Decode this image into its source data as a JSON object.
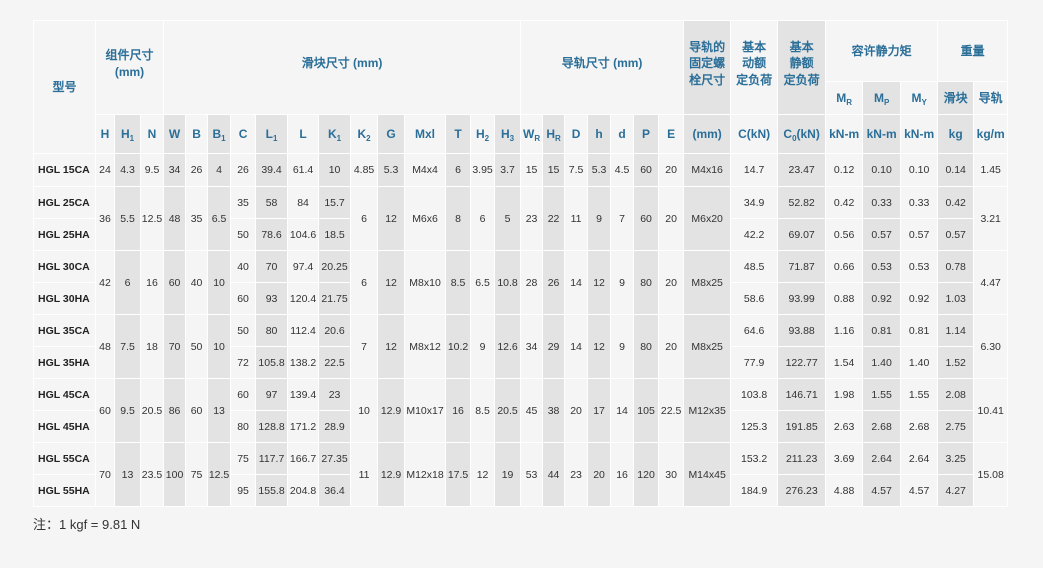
{
  "table": {
    "headers": {
      "model": "型号",
      "assembly": [
        "组件尺寸",
        "(mm)"
      ],
      "block": "滑块尺寸 (mm)",
      "rail": "导轨尺寸 (mm)",
      "bolt": [
        "导轨的",
        "固定螺",
        "栓尺寸"
      ],
      "dynamic_load": [
        "基本",
        "动额",
        "定负荷"
      ],
      "static_load": [
        "基本",
        "静额",
        "定负荷"
      ],
      "moment": "容许静力矩",
      "weight": "重量",
      "moment_axes": [
        {
          "main": "M",
          "sub": "R"
        },
        {
          "main": "M",
          "sub": "P"
        },
        {
          "main": "M",
          "sub": "Y"
        }
      ],
      "weight_parts": [
        "滑块",
        "导轨"
      ]
    },
    "columns": [
      {
        "main": "H"
      },
      {
        "main": "H",
        "sub": "1"
      },
      {
        "main": "N"
      },
      {
        "main": "W"
      },
      {
        "main": "B"
      },
      {
        "main": "B",
        "sub": "1"
      },
      {
        "main": "C"
      },
      {
        "main": "L",
        "sub": "1"
      },
      {
        "main": "L"
      },
      {
        "main": "K",
        "sub": "1"
      },
      {
        "main": "K",
        "sub": "2"
      },
      {
        "main": "G"
      },
      {
        "main": "Mxl"
      },
      {
        "main": "T"
      },
      {
        "main": "H",
        "sub": "2"
      },
      {
        "main": "H",
        "sub": "3"
      },
      {
        "main": "W",
        "sub": "R"
      },
      {
        "main": "H",
        "sub": "R"
      },
      {
        "main": "D"
      },
      {
        "main": "h"
      },
      {
        "main": "d"
      },
      {
        "main": "P"
      },
      {
        "main": "E"
      },
      {
        "main": "(mm)"
      },
      {
        "main": "C(kN)"
      },
      {
        "main": "C",
        "sub": "0",
        "tail": "(kN)"
      },
      {
        "main": "kN-m"
      },
      {
        "main": "kN-m"
      },
      {
        "main": "kN-m"
      },
      {
        "main": "kg"
      },
      {
        "main": "kg/m"
      }
    ],
    "rows": [
      {
        "model": "HGL 15CA",
        "cells": [
          "24",
          "4.3",
          "9.5",
          "34",
          "26",
          "4",
          "26",
          "39.4",
          "61.4",
          "10",
          "4.85",
          "5.3",
          "M4x4",
          "6",
          "3.95",
          "3.7",
          "15",
          "15",
          "7.5",
          "5.3",
          "4.5",
          "60",
          "20",
          "M4x16",
          "14.7",
          "23.47",
          "0.12",
          "0.10",
          "0.10",
          "0.14",
          "1.45"
        ]
      },
      {
        "model": "HGL 25CA",
        "cells": [
          "36",
          "5.5",
          "12.5",
          "48",
          "35",
          "6.5",
          "35",
          "58",
          "84",
          "15.7",
          "6",
          "12",
          "M6x6",
          "8",
          "6",
          "5",
          "23",
          "22",
          "11",
          "9",
          "7",
          "60",
          "20",
          "M6x20",
          "34.9",
          "52.82",
          "0.42",
          "0.33",
          "0.33",
          "0.42",
          "3.21"
        ]
      },
      {
        "model": "HGL 25HA",
        "cells": [
          null,
          null,
          null,
          null,
          null,
          null,
          "50",
          "78.6",
          "104.6",
          "18.5",
          null,
          null,
          null,
          null,
          null,
          null,
          null,
          null,
          null,
          null,
          null,
          null,
          null,
          null,
          "42.2",
          "69.07",
          "0.56",
          "0.57",
          "0.57",
          "0.57",
          null
        ]
      },
      {
        "model": "HGL 30CA",
        "cells": [
          "42",
          "6",
          "16",
          "60",
          "40",
          "10",
          "40",
          "70",
          "97.4",
          "20.25",
          "6",
          "12",
          "M8x10",
          "8.5",
          "6.5",
          "10.8",
          "28",
          "26",
          "14",
          "12",
          "9",
          "80",
          "20",
          "M8x25",
          "48.5",
          "71.87",
          "0.66",
          "0.53",
          "0.53",
          "0.78",
          "4.47"
        ]
      },
      {
        "model": "HGL 30HA",
        "cells": [
          null,
          null,
          null,
          null,
          null,
          null,
          "60",
          "93",
          "120.4",
          "21.75",
          null,
          null,
          null,
          null,
          null,
          null,
          null,
          null,
          null,
          null,
          null,
          null,
          null,
          null,
          "58.6",
          "93.99",
          "0.88",
          "0.92",
          "0.92",
          "1.03",
          null
        ]
      },
      {
        "model": "HGL 35CA",
        "cells": [
          "48",
          "7.5",
          "18",
          "70",
          "50",
          "10",
          "50",
          "80",
          "112.4",
          "20.6",
          "7",
          "12",
          "M8x12",
          "10.2",
          "9",
          "12.6",
          "34",
          "29",
          "14",
          "12",
          "9",
          "80",
          "20",
          "M8x25",
          "64.6",
          "93.88",
          "1.16",
          "0.81",
          "0.81",
          "1.14",
          "6.30"
        ]
      },
      {
        "model": "HGL 35HA",
        "cells": [
          null,
          null,
          null,
          null,
          null,
          null,
          "72",
          "105.8",
          "138.2",
          "22.5",
          null,
          null,
          null,
          null,
          null,
          null,
          null,
          null,
          null,
          null,
          null,
          null,
          null,
          null,
          "77.9",
          "122.77",
          "1.54",
          "1.40",
          "1.40",
          "1.52",
          null
        ]
      },
      {
        "model": "HGL 45CA",
        "cells": [
          "60",
          "9.5",
          "20.5",
          "86",
          "60",
          "13",
          "60",
          "97",
          "139.4",
          "23",
          "10",
          "12.9",
          "M10x17",
          "16",
          "8.5",
          "20.5",
          "45",
          "38",
          "20",
          "17",
          "14",
          "105",
          "22.5",
          "M12x35",
          "103.8",
          "146.71",
          "1.98",
          "1.55",
          "1.55",
          "2.08",
          "10.41"
        ]
      },
      {
        "model": "HGL 45HA",
        "cells": [
          null,
          null,
          null,
          null,
          null,
          null,
          "80",
          "128.8",
          "171.2",
          "28.9",
          null,
          null,
          null,
          null,
          null,
          null,
          null,
          null,
          null,
          null,
          null,
          null,
          null,
          null,
          "125.3",
          "191.85",
          "2.63",
          "2.68",
          "2.68",
          "2.75",
          null
        ]
      },
      {
        "model": "HGL 55CA",
        "cells": [
          "70",
          "13",
          "23.5",
          "100",
          "75",
          "12.5",
          "75",
          "117.7",
          "166.7",
          "27.35",
          "11",
          "12.9",
          "M12x18",
          "17.5",
          "12",
          "19",
          "53",
          "44",
          "23",
          "20",
          "16",
          "120",
          "30",
          "M14x45",
          "153.2",
          "211.23",
          "3.69",
          "2.64",
          "2.64",
          "3.25",
          "15.08"
        ]
      },
      {
        "model": "HGL 55HA",
        "cells": [
          null,
          null,
          null,
          null,
          null,
          null,
          "95",
          "155.8",
          "204.8",
          "36.4",
          null,
          null,
          null,
          null,
          null,
          null,
          null,
          null,
          null,
          null,
          null,
          null,
          null,
          null,
          "184.9",
          "276.23",
          "4.88",
          "4.57",
          "4.57",
          "4.27",
          null
        ]
      }
    ]
  },
  "note": "注：1 kgf = 9.81 N"
}
